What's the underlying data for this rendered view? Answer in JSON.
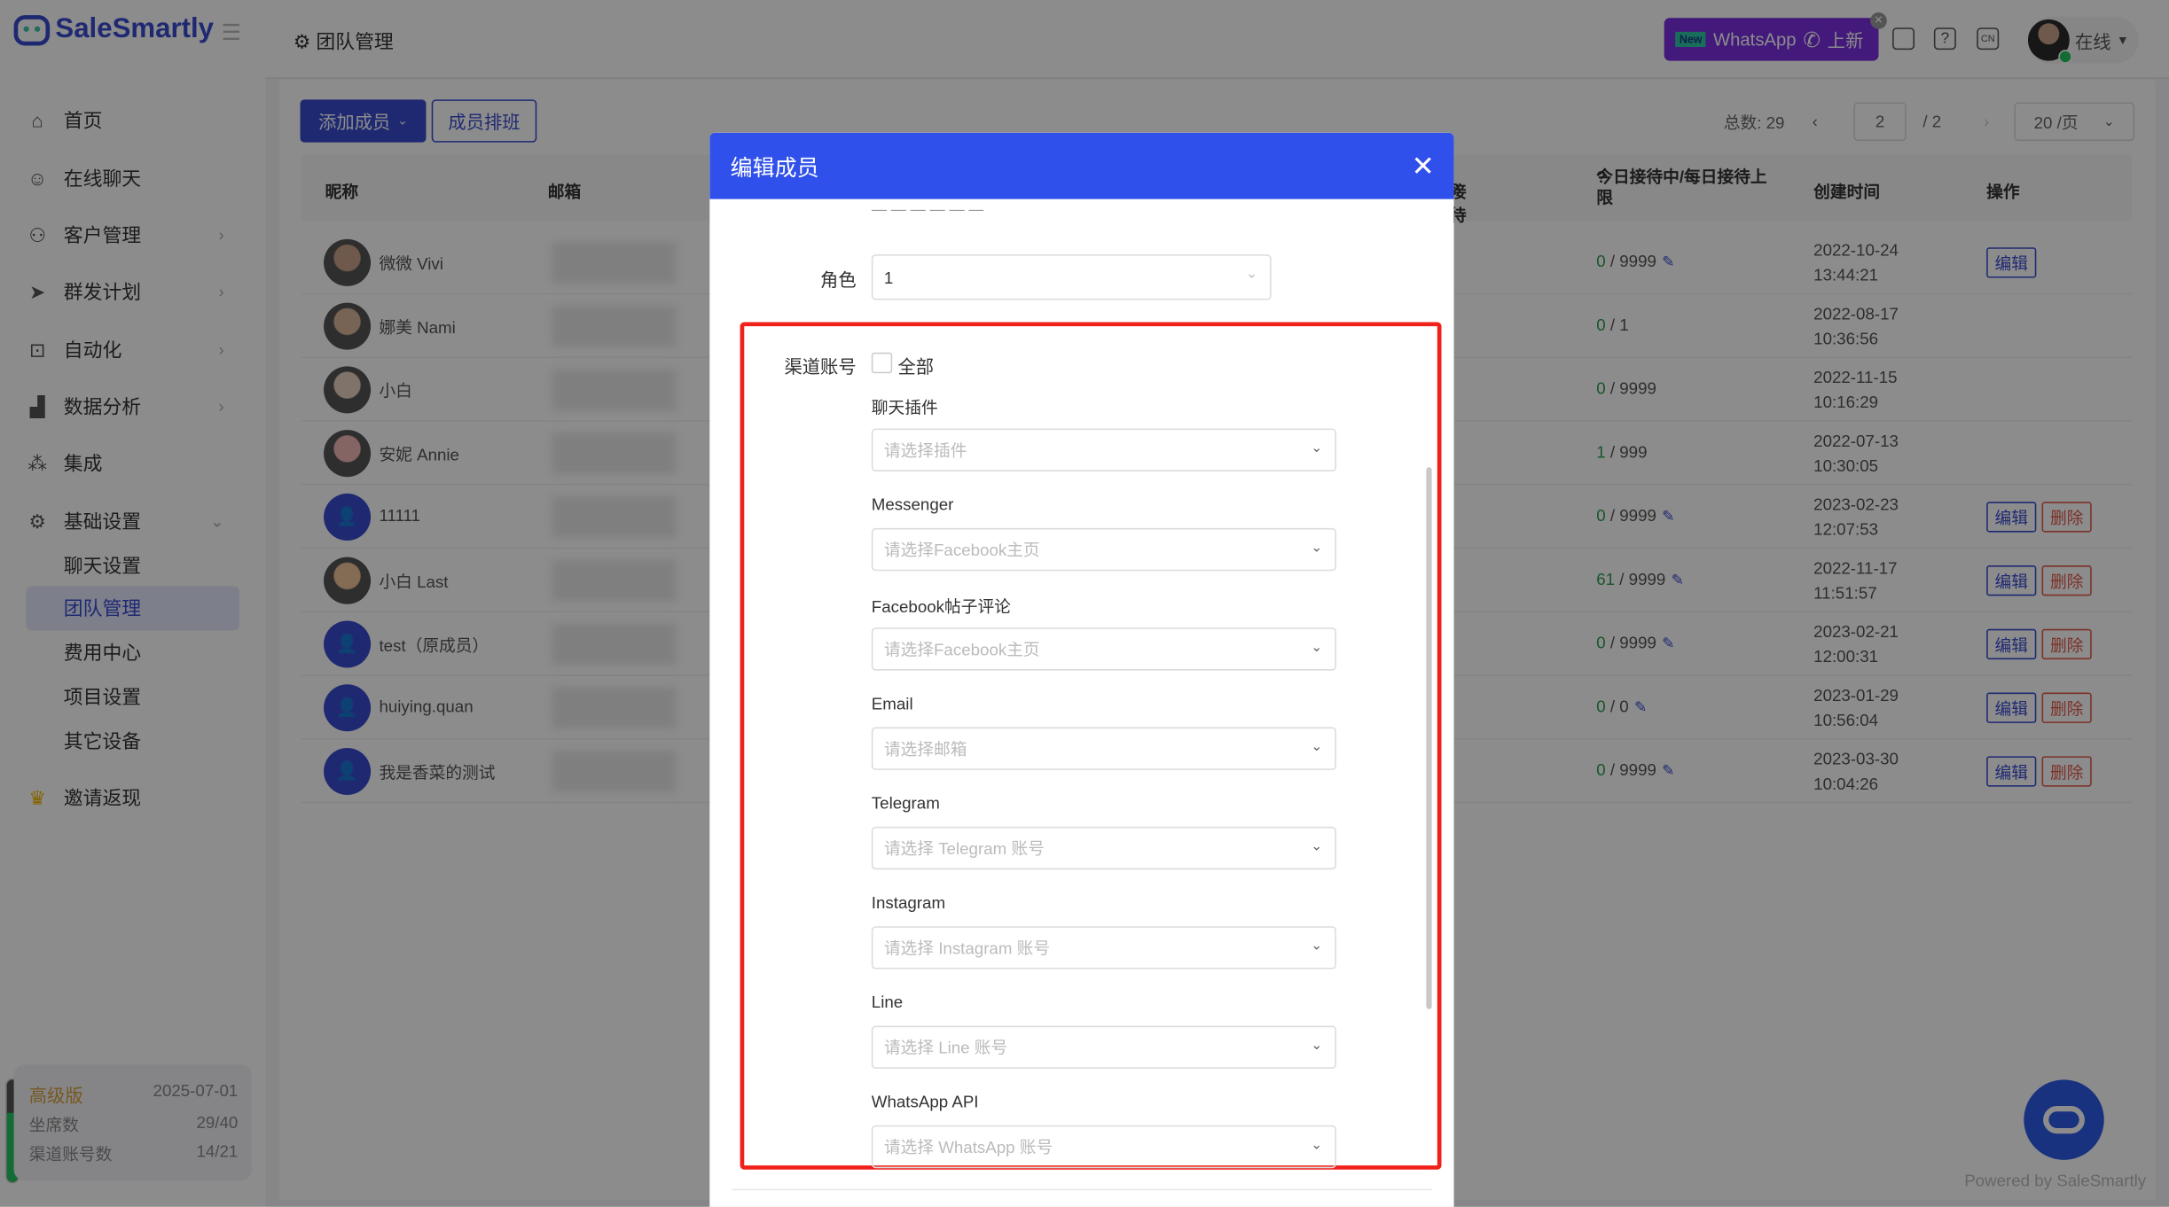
{
  "app": {
    "brand": "SaleSmartly",
    "accent": "#3a4bd0"
  },
  "sidebar": {
    "items": [
      {
        "label": "首页",
        "icon": "home-icon"
      },
      {
        "label": "在线聊天",
        "icon": "chat-icon"
      },
      {
        "label": "客户管理",
        "icon": "users-icon"
      },
      {
        "label": "群发计划",
        "icon": "send-icon"
      },
      {
        "label": "自动化",
        "icon": "robot-icon"
      },
      {
        "label": "数据分析",
        "icon": "chart-icon"
      },
      {
        "label": "集成",
        "icon": "integration-icon"
      },
      {
        "label": "基础设置",
        "icon": "gear-icon"
      }
    ],
    "sub_items": [
      {
        "label": "聊天设置"
      },
      {
        "label": "团队管理",
        "active": true
      },
      {
        "label": "费用中心"
      },
      {
        "label": "项目设置"
      },
      {
        "label": "其它设备"
      }
    ],
    "invite": "邀请返现",
    "plan": {
      "name": "高级版",
      "expiry": "2025-07-01",
      "seats_label": "坐席数",
      "seats": "29/40",
      "channels_label": "渠道账号数",
      "channels": "14/21",
      "usage_fraction": 0.67
    }
  },
  "topbar": {
    "breadcrumb": "团队管理",
    "promo_new": "New",
    "promo_text": "WhatsApp",
    "promo_suffix": "上新",
    "lang": "CN",
    "help": "?",
    "status": "在线"
  },
  "toolbar": {
    "add_member": "添加成员",
    "schedule": "成员排班",
    "total_label": "总数: 29",
    "current_page": "2",
    "total_pages": "/  2",
    "page_size": "20 /页"
  },
  "table": {
    "headers": {
      "nickname": "昵称",
      "email": "邮箱",
      "reception": "接待",
      "limit": "今日接待中/每日接待上限",
      "created": "创建时间",
      "ops": "操作"
    },
    "edit_label": "编辑",
    "delete_label": "删除",
    "rows": [
      {
        "name": "微微 Vivi",
        "cur": "0",
        "max": " / 9999",
        "pen": true,
        "date": "2022-10-24",
        "time": "13:44:21",
        "edit": true,
        "del": false,
        "avatar": "photo"
      },
      {
        "name": "娜美 Nami",
        "cur": "0",
        "max": " / 1",
        "pen": false,
        "date": "2022-08-17",
        "time": "10:36:56",
        "edit": false,
        "del": false,
        "avatar": "photo"
      },
      {
        "name": "小白",
        "cur": "0",
        "max": " / 9999",
        "pen": false,
        "date": "2022-11-15",
        "time": "10:16:29",
        "edit": false,
        "del": false,
        "avatar": "photo"
      },
      {
        "name": "安妮 Annie",
        "cur": "1",
        "max": " / 999",
        "pen": false,
        "date": "2022-07-13",
        "time": "10:30:05",
        "edit": false,
        "del": false,
        "avatar": "photo"
      },
      {
        "name": "11111",
        "cur": "0",
        "max": " / 9999",
        "pen": true,
        "date": "2023-02-23",
        "time": "12:07:53",
        "edit": true,
        "del": true,
        "avatar": "default"
      },
      {
        "name": "小白 Last",
        "cur": "61",
        "max": " / 9999",
        "pen": true,
        "date": "2022-11-17",
        "time": "11:51:57",
        "edit": true,
        "del": true,
        "avatar": "photo"
      },
      {
        "name": "test（原成员）",
        "cur": "0",
        "max": " / 9999",
        "pen": true,
        "date": "2023-02-21",
        "time": "12:00:31",
        "edit": true,
        "del": true,
        "avatar": "default"
      },
      {
        "name": "huiying.quan",
        "cur": "0",
        "max": " / 0",
        "pen": true,
        "date": "2023-01-29",
        "time": "10:56:04",
        "edit": true,
        "del": true,
        "avatar": "default"
      },
      {
        "name": "我是香菜的测试",
        "cur": "0",
        "max": " / 9999",
        "pen": true,
        "date": "2023-03-30",
        "time": "10:04:26",
        "edit": true,
        "del": true,
        "avatar": "default"
      }
    ]
  },
  "modal": {
    "title": "编辑成员",
    "role_label": "角色",
    "role_value": "1",
    "channel_label": "渠道账号",
    "all_label": "全部",
    "fields": [
      {
        "label": "聊天插件",
        "placeholder": "请选择插件"
      },
      {
        "label": "Messenger",
        "placeholder": "请选择Facebook主页"
      },
      {
        "label": "Facebook帖子评论",
        "placeholder": "请选择Facebook主页"
      },
      {
        "label": "Email",
        "placeholder": "请选择邮箱"
      },
      {
        "label": "Telegram",
        "placeholder": "请选择 Telegram 账号"
      },
      {
        "label": "Instagram",
        "placeholder": "请选择 Instagram 账号"
      },
      {
        "label": "Line",
        "placeholder": "请选择 Line 账号"
      },
      {
        "label": "WhatsApp API",
        "placeholder": "请选择 WhatsApp 账号"
      }
    ],
    "highlight_color": "#f0201a"
  },
  "footer": {
    "powered": "Powered by SaleSmartly"
  }
}
